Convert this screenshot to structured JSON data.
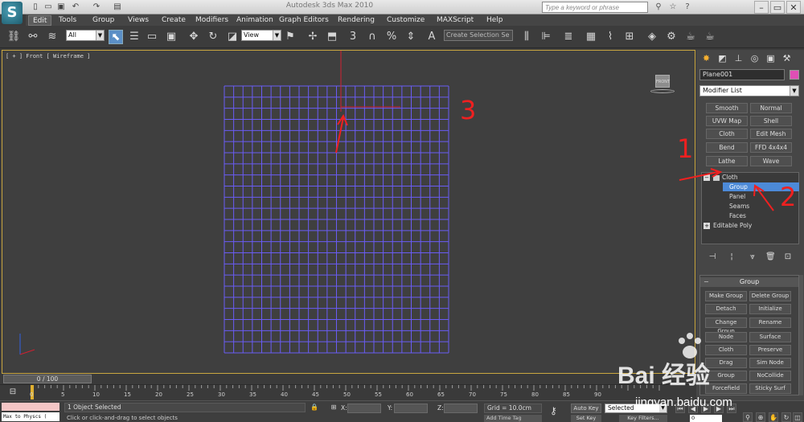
{
  "title_bar": {
    "logo": "S",
    "window_title": "Autodesk 3ds Max 2010",
    "search_placeholder": "Type a keyword or phrase",
    "quick_access_icons": [
      "new-file-icon",
      "open-folder-icon",
      "save-icon",
      "undo-icon",
      "redo-icon",
      "project-folder-icon"
    ],
    "right_icons": [
      "binoculars-icon",
      "star-icon",
      "help-icon"
    ]
  },
  "menu": {
    "items": [
      "Edit",
      "Tools",
      "Group",
      "Views",
      "Create",
      "Modifiers",
      "Animation",
      "Graph Editors",
      "Rendering",
      "Customize",
      "MAXScript",
      "Help"
    ]
  },
  "toolbar": {
    "filter_value": "All",
    "view_value": "View",
    "selection_set": "Create Selection Se",
    "snap_labels": [
      "3",
      "%",
      "A"
    ]
  },
  "viewport": {
    "label": "[ + ] Front [ Wireframe ]",
    "viewcube_label": "FRONT",
    "grid_color": "#6a5cf5",
    "axis_color": "#d02030"
  },
  "command_panel": {
    "object_name": "Plane001",
    "object_color": "#e04fb5",
    "modifier_list_label": "Modifier List",
    "modifier_buttons": [
      "Smooth",
      "Normal",
      "UVW Map",
      "Shell",
      "Cloth",
      "Edit Mesh",
      "Bend",
      "FFD 4x4x4",
      "Lathe",
      "Wave"
    ],
    "stack": {
      "cloth": "Cloth",
      "sub_items": [
        "Group",
        "Panel",
        "Seams",
        "Faces"
      ],
      "selected_sub": "Group",
      "base": "Editable Poly"
    },
    "group_rollout": {
      "title": "Group",
      "buttons": [
        "Make Group",
        "Delete Group",
        "Detach",
        "Initialize",
        "Change Group",
        "Rename",
        "Node",
        "Surface",
        "Cloth",
        "Preserve",
        "Drag",
        "Sim Node",
        "Group",
        "NoCollide",
        "Forcefield",
        "Sticky Surf"
      ]
    }
  },
  "timeline": {
    "slider_text": "0 / 100",
    "ticks": [
      "0",
      "5",
      "10",
      "15",
      "20",
      "25",
      "30",
      "35",
      "40",
      "45",
      "50",
      "55",
      "60",
      "65",
      "70",
      "75",
      "80",
      "85",
      "90"
    ]
  },
  "status": {
    "listener_top": "",
    "listener_bottom": "Max to Physcs (",
    "selection": "1 Object Selected",
    "prompt": "Click or click-and-drag to select objects",
    "x_label": "X:",
    "y_label": "Y:",
    "z_label": "Z:",
    "grid": "Grid = 10.0cm",
    "add_time_tag": "Add Time Tag",
    "auto_key": "Auto Key",
    "set_key": "Set Key",
    "selected_mode": "Selected",
    "key_filters": "Key Filters...",
    "frame": "0"
  },
  "annotations": {
    "label_1": "1",
    "label_2": "2",
    "label_3": "3",
    "color": "#f02020"
  },
  "watermark": {
    "brand": "Bai  经验",
    "url": "jingyan.baidu.com"
  }
}
